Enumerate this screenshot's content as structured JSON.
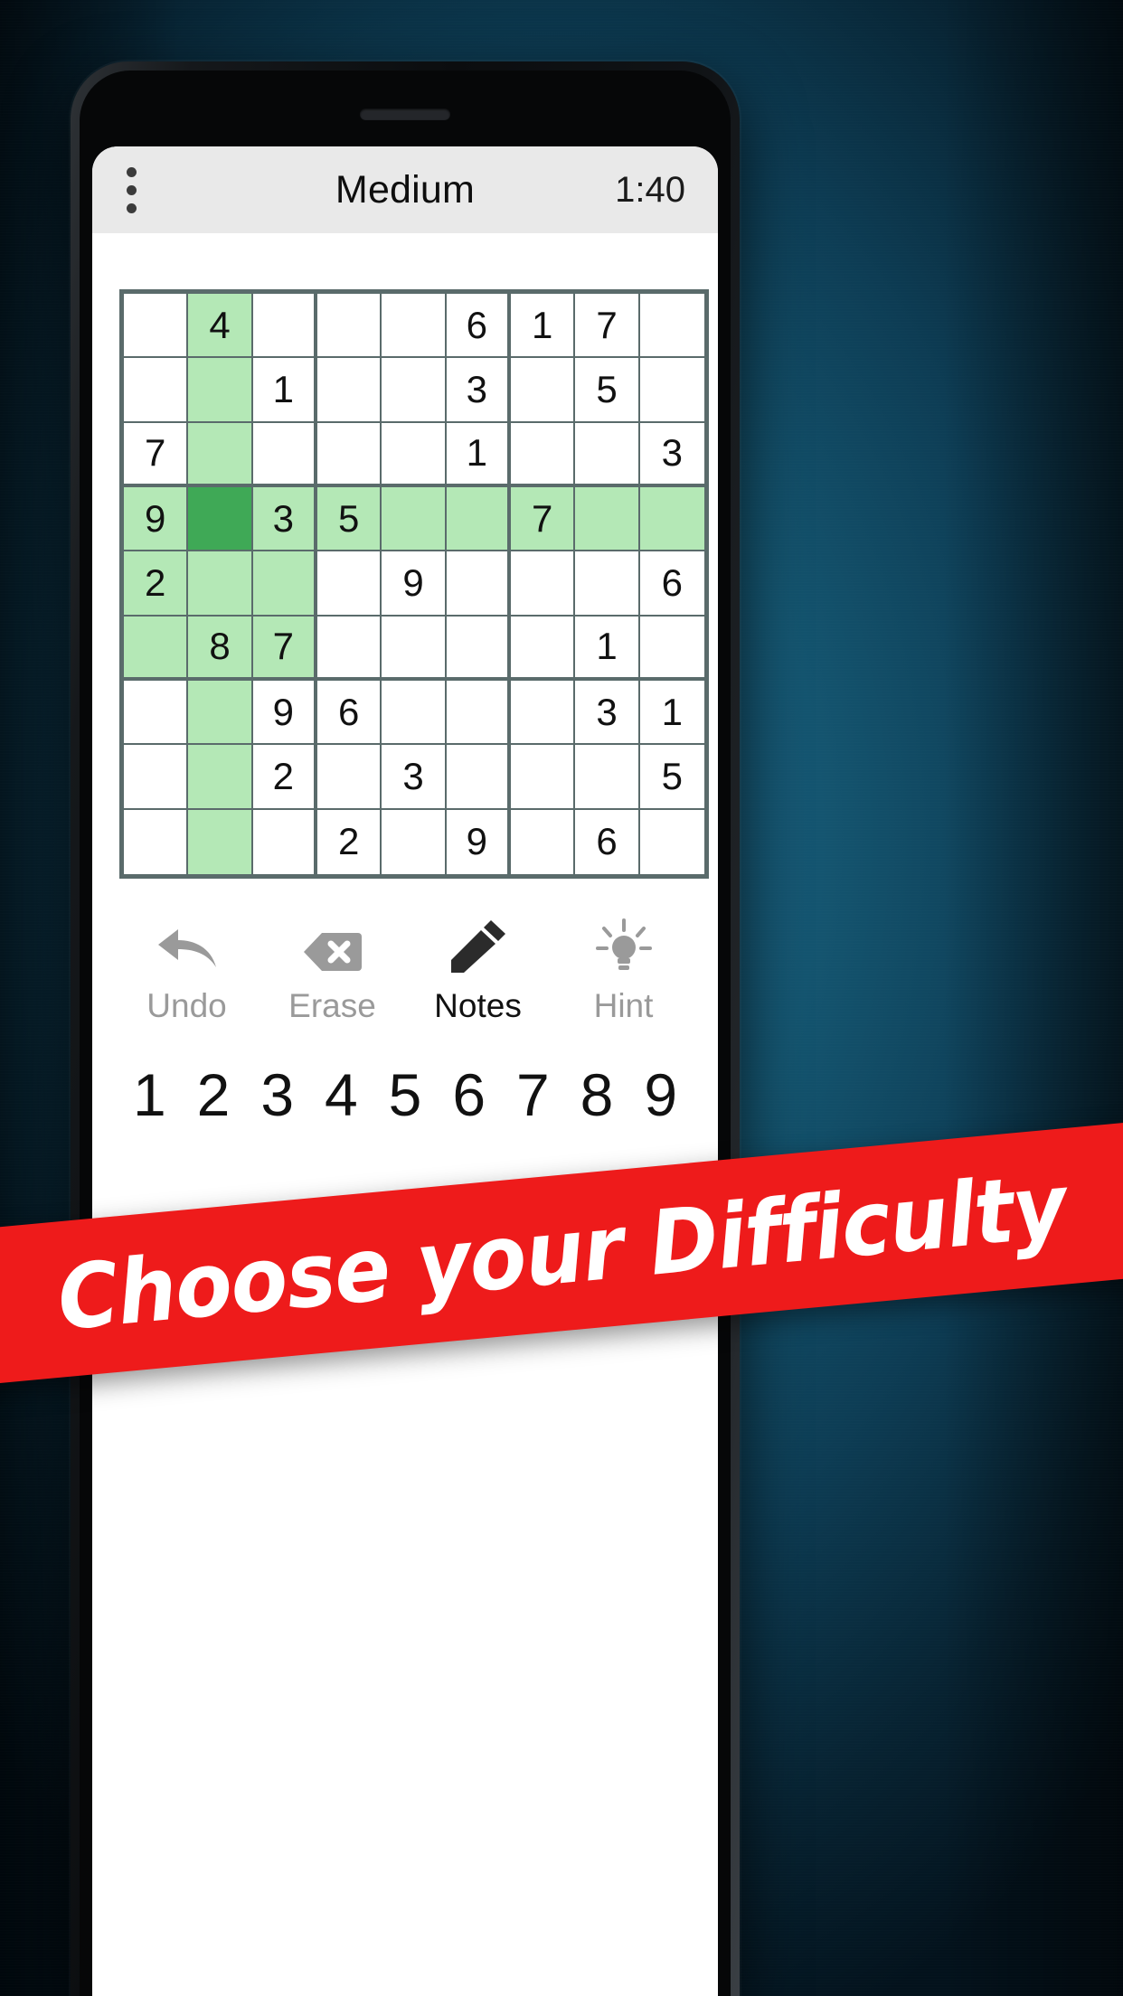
{
  "theme": {
    "background_top": "#0e4054",
    "background_deep": "#03121c",
    "banner_color": "#ee1b1b",
    "grid_line": "#5a6b6b",
    "highlight": "#b4e8b6",
    "selected": "#3fa956",
    "appbar_bg": "#e9e9e9"
  },
  "appbar": {
    "menu_icon": "overflow-menu-icon",
    "title": "Medium",
    "timer": "1:40"
  },
  "board": {
    "rows": 9,
    "cols": 9,
    "selected_cell": {
      "row": 4,
      "col": 2
    },
    "cells": [
      [
        "",
        "4",
        "",
        "",
        "",
        "6",
        "1",
        "7",
        ""
      ],
      [
        "",
        "",
        "1",
        "",
        "",
        "3",
        "",
        "5",
        ""
      ],
      [
        "7",
        "",
        "",
        "",
        "",
        "1",
        "",
        "",
        "3"
      ],
      [
        "9",
        "",
        "3",
        "5",
        "",
        "",
        "7",
        "",
        ""
      ],
      [
        "2",
        "",
        "",
        "",
        "9",
        "",
        "",
        "",
        "6"
      ],
      [
        "",
        "8",
        "7",
        "",
        "",
        "",
        "",
        "1",
        ""
      ],
      [
        "",
        "",
        "9",
        "6",
        "",
        "",
        "",
        "3",
        "1"
      ],
      [
        "",
        "",
        "2",
        "",
        "3",
        "",
        "",
        "",
        "5"
      ],
      [
        "",
        "",
        "",
        "2",
        "",
        "9",
        "",
        "6",
        ""
      ]
    ],
    "highlighted_row": 4,
    "highlighted_col": 2,
    "extra_highlights": [
      {
        "row": 5,
        "col": 1
      },
      {
        "row": 5,
        "col": 3
      },
      {
        "row": 6,
        "col": 1
      },
      {
        "row": 6,
        "col": 3
      }
    ]
  },
  "actions": [
    {
      "label": "Undo",
      "icon": "undo-arrow-icon",
      "state": "dim"
    },
    {
      "label": "Erase",
      "icon": "erase-icon",
      "state": "dim"
    },
    {
      "label": "Notes",
      "icon": "pencil-icon",
      "state": "active"
    },
    {
      "label": "Hint",
      "icon": "lightbulb-icon",
      "state": "dim"
    }
  ],
  "numpad": [
    "1",
    "2",
    "3",
    "4",
    "5",
    "6",
    "7",
    "8",
    "9"
  ],
  "banner": {
    "text": "Choose your Difficulty"
  }
}
